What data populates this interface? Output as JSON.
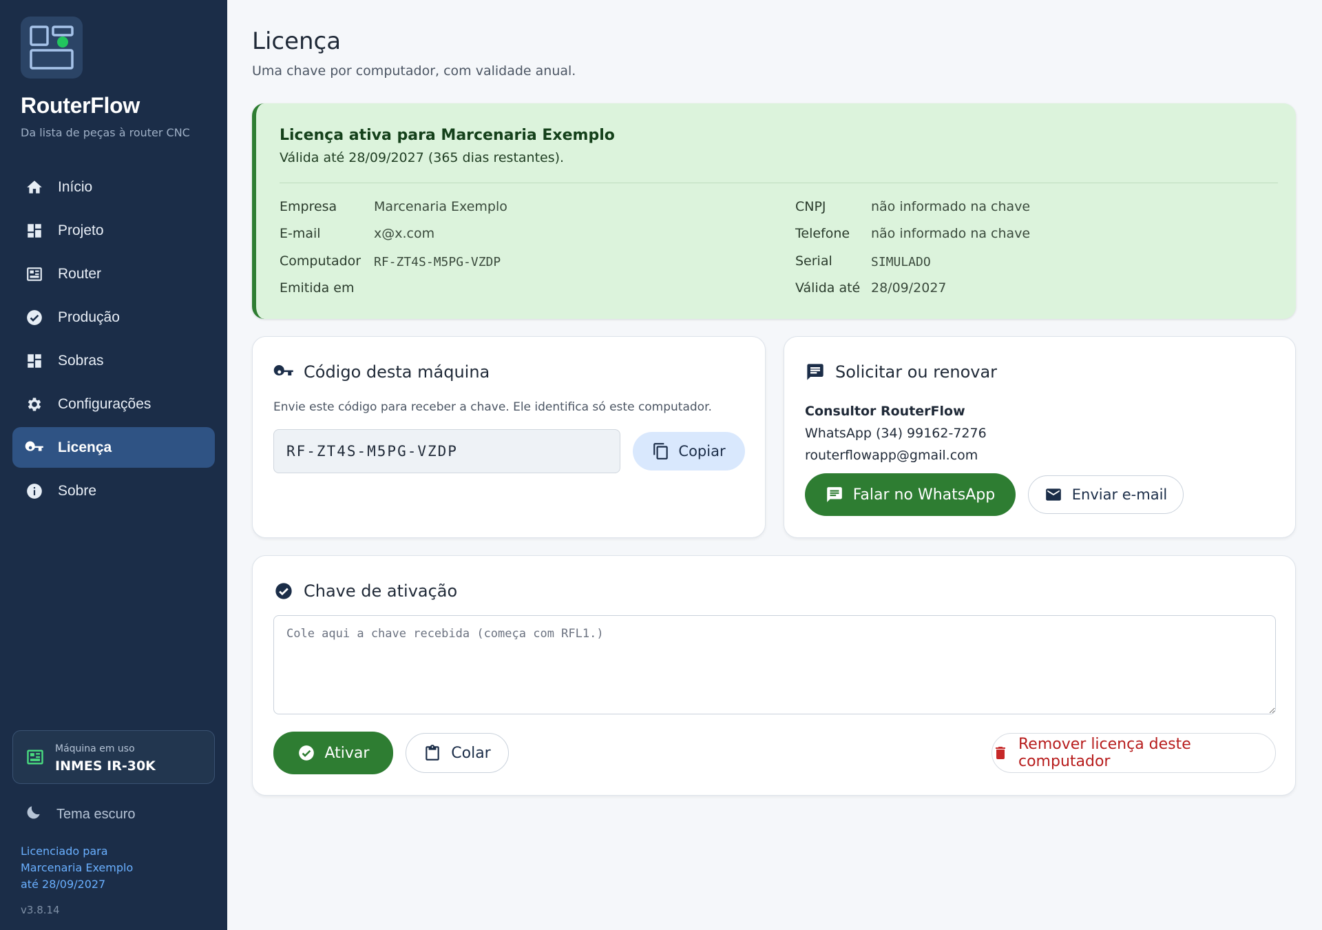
{
  "app": {
    "name": "RouterFlow",
    "tagline": "Da lista de peças à router CNC",
    "version": "v3.8.14"
  },
  "sidebar": {
    "items": [
      {
        "label": "Início",
        "icon": "home-icon"
      },
      {
        "label": "Projeto",
        "icon": "dashboard-icon"
      },
      {
        "label": "Router",
        "icon": "router-icon"
      },
      {
        "label": "Produção",
        "icon": "check-circle-icon"
      },
      {
        "label": "Sobras",
        "icon": "dashboard-icon"
      },
      {
        "label": "Configurações",
        "icon": "gear-icon"
      },
      {
        "label": "Licença",
        "icon": "key-icon",
        "active": true
      },
      {
        "label": "Sobre",
        "icon": "info-icon"
      }
    ],
    "machine": {
      "label": "Máquina em uso",
      "value": "INMES IR-30K"
    },
    "theme_toggle": "Tema escuro",
    "licensed": {
      "line1": "Licenciado para",
      "line2": "Marcenaria Exemplo",
      "line3": "até 28/09/2027"
    }
  },
  "page": {
    "title": "Licença",
    "subtitle": "Uma chave por computador, com validade anual."
  },
  "license_status": {
    "title": "Licença ativa para Marcenaria Exemplo",
    "subtitle": "Válida até 28/09/2027 (365 dias restantes).",
    "left": [
      {
        "key": "Empresa",
        "value": "Marcenaria Exemplo"
      },
      {
        "key": "E-mail",
        "value": "x@x.com"
      },
      {
        "key": "Computador",
        "value": "RF-ZT4S-M5PG-VZDP"
      },
      {
        "key": "Emitida em",
        "value": ""
      }
    ],
    "right": [
      {
        "key": "CNPJ",
        "value": "não informado na chave"
      },
      {
        "key": "Telefone",
        "value": "não informado na chave"
      },
      {
        "key": "Serial",
        "value": "SIMULADO"
      },
      {
        "key": "Válida até",
        "value": "28/09/2027"
      }
    ]
  },
  "machine_code": {
    "title": "Código desta máquina",
    "description": "Envie este código para receber a chave. Ele identifica só este computador.",
    "code": "RF-ZT4S-M5PG-VZDP",
    "copy_label": "Copiar"
  },
  "request": {
    "title": "Solicitar ou renovar",
    "consultant_name": "Consultor RouterFlow",
    "whatsapp": "WhatsApp (34) 99162-7276",
    "email": "routerflowapp@gmail.com",
    "whatsapp_button": "Falar no WhatsApp",
    "email_button": "Enviar e-mail"
  },
  "activation": {
    "title": "Chave de ativação",
    "placeholder": "Cole aqui a chave recebida (começa com RFL1.)",
    "activate_label": "Ativar",
    "paste_label": "Colar",
    "remove_label": "Remover licença deste computador"
  },
  "colors": {
    "sidebar_bg": "#1b2d48",
    "sidebar_active": "#2f5384",
    "success_green": "#2e7d32",
    "banner_bg": "#dcf3dc",
    "danger_red": "#b71c1c",
    "link_blue": "#6ab0ff"
  }
}
